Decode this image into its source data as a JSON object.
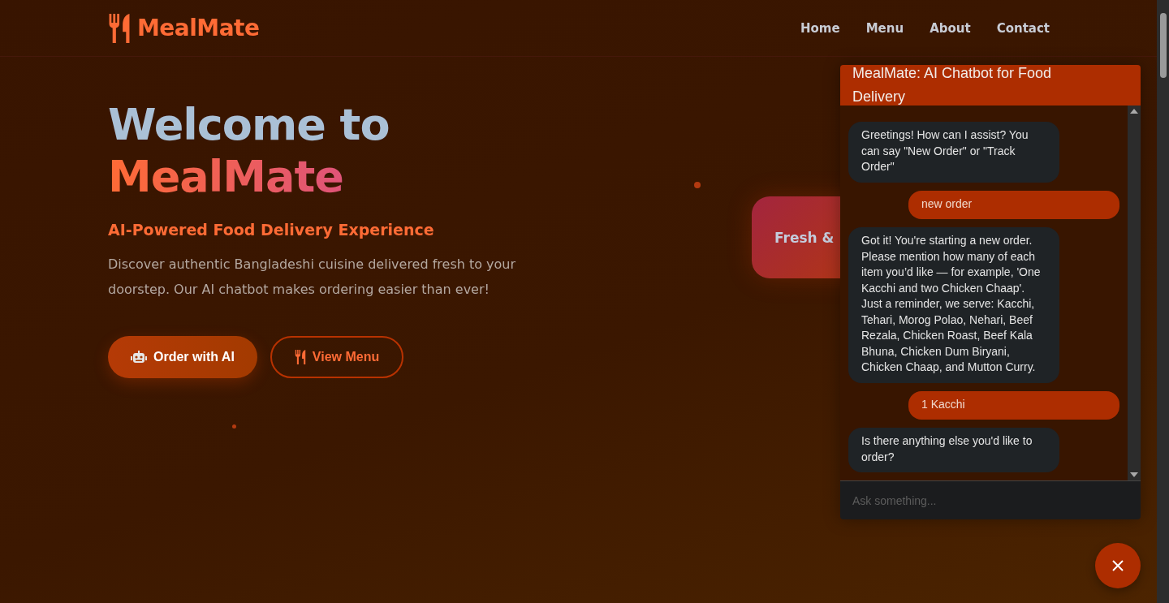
{
  "brand": "MealMate",
  "nav": [
    {
      "label": "Home"
    },
    {
      "label": "Menu"
    },
    {
      "label": "About"
    },
    {
      "label": "Contact"
    }
  ],
  "hero": {
    "title_line1": "Welcome to",
    "title_line2": "MealMate",
    "subtitle": "AI-Powered Food Delivery Experience",
    "description": "Discover authentic Bangladeshi cuisine delivered fresh to your doorstep. Our AI chatbot makes ordering easier than ever!",
    "primary_button": "Order with AI",
    "secondary_button": "View Menu"
  },
  "feature_card": {
    "label": "Fresh &"
  },
  "chat": {
    "title": "MealMate: AI Chatbot for Food Delivery",
    "placeholder": "Ask something...",
    "messages": [
      {
        "kind": "bot",
        "text": "Greetings! How can I assist? You can say \"New Order\" or \"Track Order\""
      },
      {
        "kind": "user",
        "text": "new order"
      },
      {
        "kind": "bot",
        "text": "Got it! You're starting a new order. Please mention how many of each item you’d like — for example, 'One Kacchi and two Chicken Chaap'. Just a reminder, we serve: Kacchi, Tehari, Morog Polao, Nehari, Beef Rezala, Chicken Roast, Beef Kala Bhuna, Chicken Dum Biryani, Chicken Chaap, and Mutton Curry."
      },
      {
        "kind": "user",
        "text": "1 Kacchi"
      },
      {
        "kind": "bot",
        "text": "Is there anything else you'd like to order?"
      }
    ]
  }
}
